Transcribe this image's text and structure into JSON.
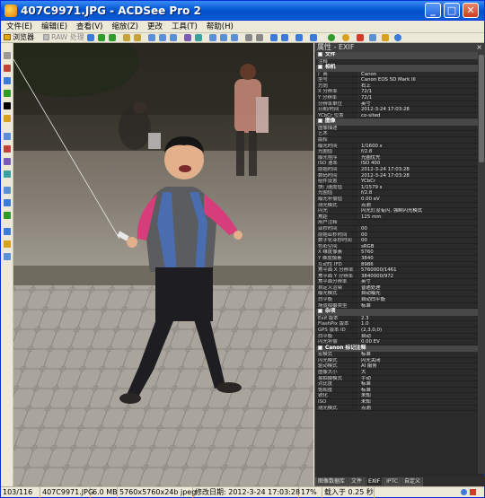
{
  "window": {
    "title": "407C9971.JPG - ACDSee Pro 2",
    "min": "_",
    "max": "□",
    "close": "✕"
  },
  "menu": [
    "文件(E)",
    "编辑(E)",
    "查看(V)",
    "缩放(Z)",
    "更改",
    "工具(T)",
    "帮助(H)"
  ],
  "toolbar": {
    "browse": "浏览器",
    "raw": "RAW 处理"
  },
  "panel": {
    "title": "属性 - EXIF",
    "close": "×"
  },
  "exif": [
    {
      "section": "文件"
    },
    {
      "k": "注释",
      "v": ""
    },
    {
      "section": "相机"
    },
    {
      "k": "厂商",
      "v": "Canon"
    },
    {
      "k": "型号",
      "v": "Canon EOS 5D Mark III"
    },
    {
      "k": "方向",
      "v": "右上"
    },
    {
      "k": "X 分辨率",
      "v": "72/1"
    },
    {
      "k": "Y 分辨率",
      "v": "72/1"
    },
    {
      "k": "分辨率单位",
      "v": "英寸"
    },
    {
      "k": "日期/时间",
      "v": "2012-3-24 17:03:28"
    },
    {
      "k": "YCbCr 位置",
      "v": "co-sited"
    },
    {
      "section": "图像"
    },
    {
      "k": "图像描述",
      "v": ""
    },
    {
      "k": "艺术",
      "v": ""
    },
    {
      "k": "版权",
      "v": ""
    },
    {
      "k": "曝光时间",
      "v": "1/1600 s"
    },
    {
      "k": "光圈值",
      "v": "f/2.8"
    },
    {
      "k": "曝光程序",
      "v": "光圈优先"
    },
    {
      "k": "ISO 速率",
      "v": "ISO 400"
    },
    {
      "k": "原始时间",
      "v": "2012-3-24 17:03:28"
    },
    {
      "k": "数码时间",
      "v": "2012-3-24 17:03:28"
    },
    {
      "k": "组件设置",
      "v": "YCbCr"
    },
    {
      "k": "快门速度值",
      "v": "1/1579 s"
    },
    {
      "k": "光圈值",
      "v": "f/2.8"
    },
    {
      "k": "曝光补偿值",
      "v": "0.00 eV"
    },
    {
      "k": "测光模式",
      "v": "点测"
    },
    {
      "k": "闪光",
      "v": "闪光灯没有闪, 强制闪光模式"
    },
    {
      "k": "焦距",
      "v": "125 mm"
    },
    {
      "k": "用户注释",
      "v": ""
    },
    {
      "k": "亚秒时间",
      "v": "00"
    },
    {
      "k": "原始亚秒时间",
      "v": "00"
    },
    {
      "k": "数字化亚秒时间",
      "v": "00"
    },
    {
      "k": "色彩空间",
      "v": "sRGB"
    },
    {
      "k": "X 维度像素",
      "v": "5760"
    },
    {
      "k": "Y 维度像素",
      "v": "3840"
    },
    {
      "k": "互动性 IFD",
      "v": "8986"
    },
    {
      "k": "焦平面 X 分辨率",
      "v": "5760000/1461"
    },
    {
      "k": "焦平面 Y 分辨率",
      "v": "3840000/972"
    },
    {
      "k": "焦平面分辨率",
      "v": "英寸"
    },
    {
      "k": "自定义渲染",
      "v": "普通处理"
    },
    {
      "k": "曝光模式",
      "v": "自动曝光"
    },
    {
      "k": "白平衡",
      "v": "自动白平衡"
    },
    {
      "k": "场景拍摄类型",
      "v": "标准"
    },
    {
      "section": "杂项"
    },
    {
      "k": "Exif 版本",
      "v": "2.3"
    },
    {
      "k": "FlashPix 版本",
      "v": "1.0"
    },
    {
      "k": "GPS 版本 ID",
      "v": "(2,3,0,0)"
    },
    {
      "k": "白平衡",
      "v": "自动"
    },
    {
      "k": "闪光补偿",
      "v": "0.00 EV"
    },
    {
      "section": "Canon 标记注释"
    },
    {
      "k": "宏模式",
      "v": "标准"
    },
    {
      "k": "闪光模式",
      "v": "闪光关闭"
    },
    {
      "k": "驱动模式",
      "v": "AI 服务"
    },
    {
      "k": "图像大小",
      "v": "大"
    },
    {
      "k": "易拍摄模式",
      "v": "手动"
    },
    {
      "k": "对比度",
      "v": "标准"
    },
    {
      "k": "饱和度",
      "v": "标准"
    },
    {
      "k": "锐化",
      "v": "未知"
    },
    {
      "k": "ISO",
      "v": "未知"
    },
    {
      "k": "测光模式",
      "v": "点测"
    }
  ],
  "tabs": [
    "图像数据库",
    "文件",
    "EXIF",
    "IPTC",
    "自定义"
  ],
  "status": {
    "index": "103/116",
    "filename": "407C9971.JPG",
    "filesize": "6.0 MB",
    "dimensions": "5760x5760x24b jpeg",
    "modified": "修改日期: 2012-3-24 17:03:28",
    "zoom": "17%",
    "load": "载入于 0.25 秒"
  },
  "colors": {
    "titlebar": "#0a5fd8",
    "panel_bg": "#2a2a2a",
    "accent": "#e5a316"
  }
}
